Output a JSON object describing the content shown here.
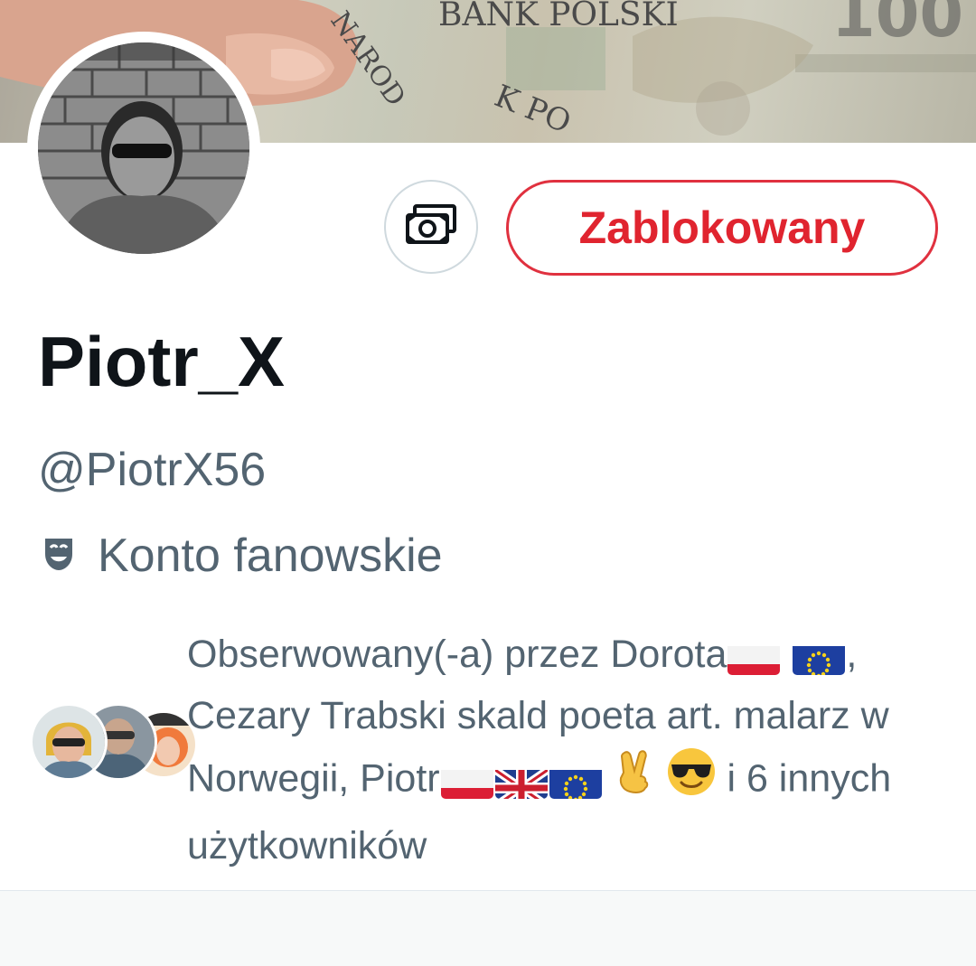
{
  "banner": {
    "text_bank": "BANK POLSKI",
    "text_narod": "NAROD",
    "text_kp": "K PO"
  },
  "profile": {
    "display_name": "Piotr_X",
    "handle": "@PiotrX56",
    "account_type": "Konto fanowskie",
    "account_icon": "theater-masks-icon"
  },
  "actions": {
    "money_icon": "money-icon",
    "blocked_label": "Zablokowany"
  },
  "followed_by": {
    "prefix": "Obserwowany(-a) przez Dorota",
    "sep1": ", Cezary Trabski skald poeta art. malarz w Norwegii, Piotr",
    "suffix": " i 6 innych użytkowników"
  },
  "colors": {
    "danger": "#e0242f",
    "text_primary": "#0f1419",
    "text_secondary": "#536471"
  }
}
